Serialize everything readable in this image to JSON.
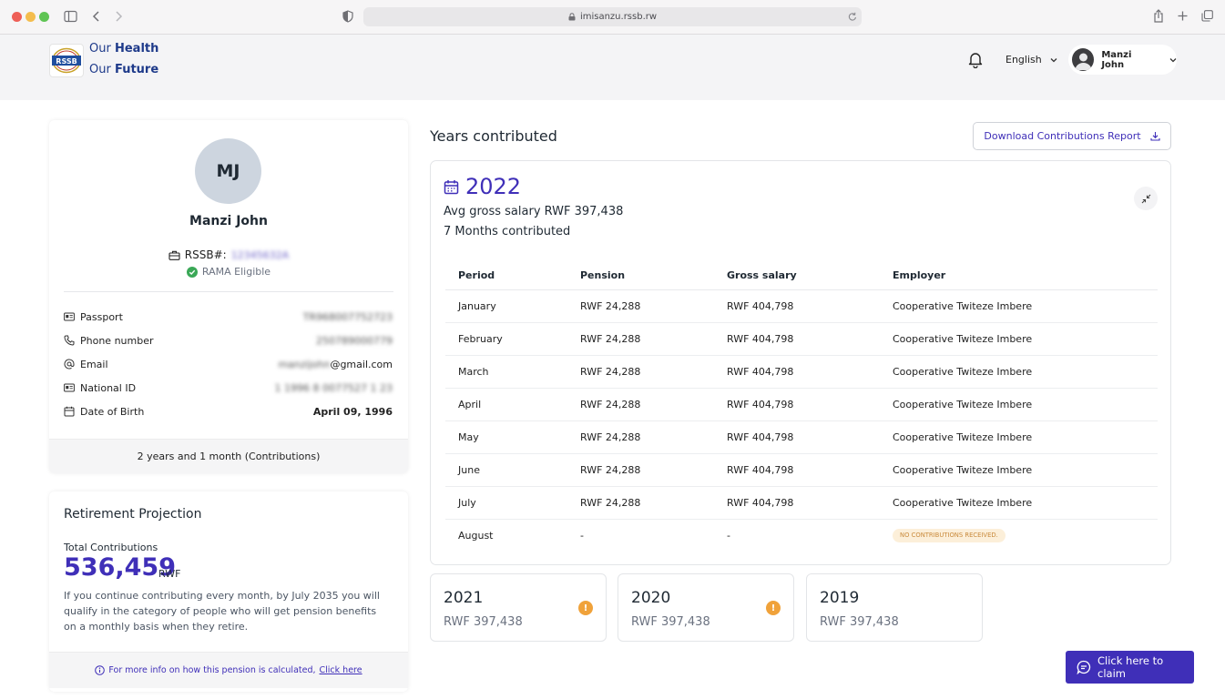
{
  "browser": {
    "url": "imisanzu.rssb.rw",
    "traffic_lights": [
      "#ee5f57",
      "#f4bd4e",
      "#5fc454"
    ]
  },
  "header": {
    "logo_text": "RSSB",
    "tagline_line1_pre": "Our",
    "tagline_line1_bold": "Health",
    "tagline_line2_pre": "Our",
    "tagline_line2_bold": "Future",
    "language": "English",
    "user_name": "Manzi John"
  },
  "profile": {
    "initials": "MJ",
    "name": "Manzi John",
    "rssb_label": "RSSB#:",
    "rssb_number": "12345632A",
    "rama_status": "RAMA Eligible",
    "details": [
      {
        "icon": "passport-icon",
        "label": "Passport",
        "value": "TR968007752723",
        "blurred": true
      },
      {
        "icon": "phone-icon",
        "label": "Phone number",
        "value": "250789000779",
        "blurred": true
      },
      {
        "icon": "at-icon",
        "label": "Email",
        "value_blurred": "manzijohn",
        "value_suffix": "@gmail.com"
      },
      {
        "icon": "id-card-icon",
        "label": "National ID",
        "value": "1 1996 8 0077527 1 23",
        "blurred": true
      },
      {
        "icon": "calendar-icon",
        "label": "Date of Birth",
        "value": "April 09, 1996",
        "blurred": false
      }
    ],
    "contribution_duration": "2 years and 1 month (Contributions)"
  },
  "retirement": {
    "title": "Retirement Projection",
    "total_label": "Total Contributions",
    "total_value": "536,459",
    "total_unit": "RWF",
    "description": "If you continue contributing every month, by July 2035 you will qualify in the category of people who will get pension benefits on a monthly basis when they retire.",
    "info_text": "For more info on how this pension is calculated,",
    "info_link": "Click here"
  },
  "contributions": {
    "title": "Years contributed",
    "download_label": "Download Contributions Report",
    "current": {
      "year": "2022",
      "avg_salary": "Avg gross salary RWF 397,438",
      "months": "7 Months contributed",
      "columns": [
        "Period",
        "Pension",
        "Gross salary",
        "Employer"
      ],
      "rows": [
        {
          "period": "January",
          "pension": "RWF 24,288",
          "gross": "RWF 404,798",
          "employer": "Cooperative Twiteze Imbere"
        },
        {
          "period": "February",
          "pension": "RWF 24,288",
          "gross": "RWF 404,798",
          "employer": "Cooperative Twiteze Imbere"
        },
        {
          "period": "March",
          "pension": "RWF 24,288",
          "gross": "RWF 404,798",
          "employer": "Cooperative Twiteze Imbere"
        },
        {
          "period": "April",
          "pension": "RWF 24,288",
          "gross": "RWF 404,798",
          "employer": "Cooperative Twiteze Imbere"
        },
        {
          "period": "May",
          "pension": "RWF 24,288",
          "gross": "RWF 404,798",
          "employer": "Cooperative Twiteze Imbere"
        },
        {
          "period": "June",
          "pension": "RWF 24,288",
          "gross": "RWF 404,798",
          "employer": "Cooperative Twiteze Imbere"
        },
        {
          "period": "July",
          "pension": "RWF 24,288",
          "gross": "RWF 404,798",
          "employer": "Cooperative Twiteze Imbere"
        },
        {
          "period": "August",
          "pension": "-",
          "gross": "-",
          "employer": "",
          "badge": "NO CONTRIBUTIONS RECEIVED."
        }
      ]
    },
    "other_years": [
      {
        "year": "2021",
        "value": "RWF 397,438",
        "warning": true
      },
      {
        "year": "2020",
        "value": "RWF 397,438",
        "warning": true
      },
      {
        "year": "2019",
        "value": "RWF 397,438",
        "warning": false
      }
    ]
  },
  "claim_button": "Click here to claim",
  "colors": {
    "accent": "#3f2fb8",
    "success": "#3aa857",
    "warning": "#f0a23a"
  }
}
